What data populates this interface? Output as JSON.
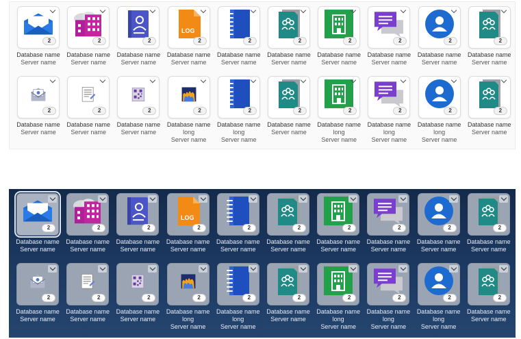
{
  "badge_count": "2",
  "labels": {
    "database": "Database name",
    "database_long_1": "Database name",
    "database_long_2": "long",
    "server": "Server name"
  },
  "colors": {
    "light_bg": "#fafafa",
    "dark_bg": "#1d3a63",
    "blue": "#1f6fd6",
    "magenta": "#b21f9a",
    "indigo": "#4b55c8",
    "orange": "#f28a16",
    "teal": "#1f8a86",
    "green": "#22a14a",
    "purple": "#7b3fd0",
    "circle_blue": "#1d6bd0"
  },
  "panels": [
    {
      "theme": "light",
      "rows": [
        {
          "tiles": [
            {
              "icon": "mail-envelope-icon",
              "label": "Database name",
              "server": "Server name"
            },
            {
              "icon": "building-cloud-icon",
              "label": "Database name",
              "server": "Server name"
            },
            {
              "icon": "contact-book-icon",
              "label": "Database name",
              "server": "Server name"
            },
            {
              "icon": "log-file-icon",
              "label": "Database name",
              "server": "Server name"
            },
            {
              "icon": "notebook-icon",
              "label": "Database name",
              "server": "Server name"
            },
            {
              "icon": "group-document-icon",
              "label": "Database name",
              "server": "Server name"
            },
            {
              "icon": "office-building-icon",
              "label": "Database name",
              "server": "Server name"
            },
            {
              "icon": "chat-bubbles-icon",
              "label": "Database name",
              "server": "Server name"
            },
            {
              "icon": "person-circle-icon",
              "label": "Database name",
              "server": "Server name"
            },
            {
              "icon": "group-document-icon",
              "label": "Database name",
              "server": "Server name"
            }
          ]
        },
        {
          "tiles": [
            {
              "icon": "mail-open-small-icon",
              "label": "Database name",
              "server": "Server name"
            },
            {
              "icon": "form-document-icon",
              "label": "Database name",
              "server": "Server name"
            },
            {
              "icon": "qr-document-icon",
              "label": "Database name",
              "server": "Server name"
            },
            {
              "icon": "fire-pattern-icon",
              "label": "Database name",
              "label2": "long",
              "server": "Server name"
            },
            {
              "icon": "notebook-icon",
              "label": "Database name",
              "label2": "long",
              "server": "Server name"
            },
            {
              "icon": "group-document-icon",
              "label": "Database name",
              "server": "Server name"
            },
            {
              "icon": "office-building-icon",
              "label": "Database name",
              "label2": "long",
              "server": "Server name"
            },
            {
              "icon": "chat-bubbles-icon",
              "label": "Database name",
              "label2": "long",
              "server": "Server name"
            },
            {
              "icon": "person-circle-icon",
              "label": "Database name",
              "label2": "long",
              "server": "Server name"
            },
            {
              "icon": "group-document-icon",
              "label": "Database name",
              "server": "Server name"
            }
          ]
        }
      ]
    },
    {
      "theme": "dark",
      "rows": [
        {
          "tiles": [
            {
              "icon": "mail-envelope-icon",
              "label": "Database name",
              "server": "Server name",
              "selected": true
            },
            {
              "icon": "building-cloud-icon",
              "label": "Database name",
              "server": "Server name"
            },
            {
              "icon": "contact-book-icon",
              "label": "Database name",
              "server": "Server name"
            },
            {
              "icon": "log-file-icon",
              "label": "Database name",
              "server": "Server name"
            },
            {
              "icon": "notebook-icon",
              "label": "Database name",
              "server": "Server name"
            },
            {
              "icon": "group-document-icon",
              "label": "Database name",
              "server": "Server name"
            },
            {
              "icon": "office-building-icon",
              "label": "Database name",
              "server": "Server name"
            },
            {
              "icon": "chat-bubbles-icon",
              "label": "Database name",
              "server": "Server name"
            },
            {
              "icon": "person-circle-icon",
              "label": "Database name",
              "server": "Server name"
            },
            {
              "icon": "group-document-icon",
              "label": "Database name",
              "server": "Server name"
            }
          ]
        },
        {
          "tiles": [
            {
              "icon": "mail-open-small-icon",
              "label": "Database name",
              "server": "Server name"
            },
            {
              "icon": "form-document-icon",
              "label": "Database name",
              "server": "Server name"
            },
            {
              "icon": "qr-document-icon",
              "label": "Database name",
              "server": "Server name"
            },
            {
              "icon": "fire-pattern-icon",
              "label": "Database name",
              "label2": "long",
              "server": "Server name"
            },
            {
              "icon": "notebook-icon",
              "label": "Database name",
              "label2": "long",
              "server": "Server name"
            },
            {
              "icon": "group-document-icon",
              "label": "Database name",
              "server": "Server name"
            },
            {
              "icon": "office-building-icon",
              "label": "Database name",
              "label2": "long",
              "server": "Server name"
            },
            {
              "icon": "chat-bubbles-icon",
              "label": "Database name",
              "label2": "long",
              "server": "Server name"
            },
            {
              "icon": "person-circle-icon",
              "label": "Database name",
              "label2": "long",
              "server": "Server name"
            },
            {
              "icon": "group-document-icon",
              "label": "Database name",
              "server": "Server name"
            }
          ]
        }
      ]
    }
  ]
}
